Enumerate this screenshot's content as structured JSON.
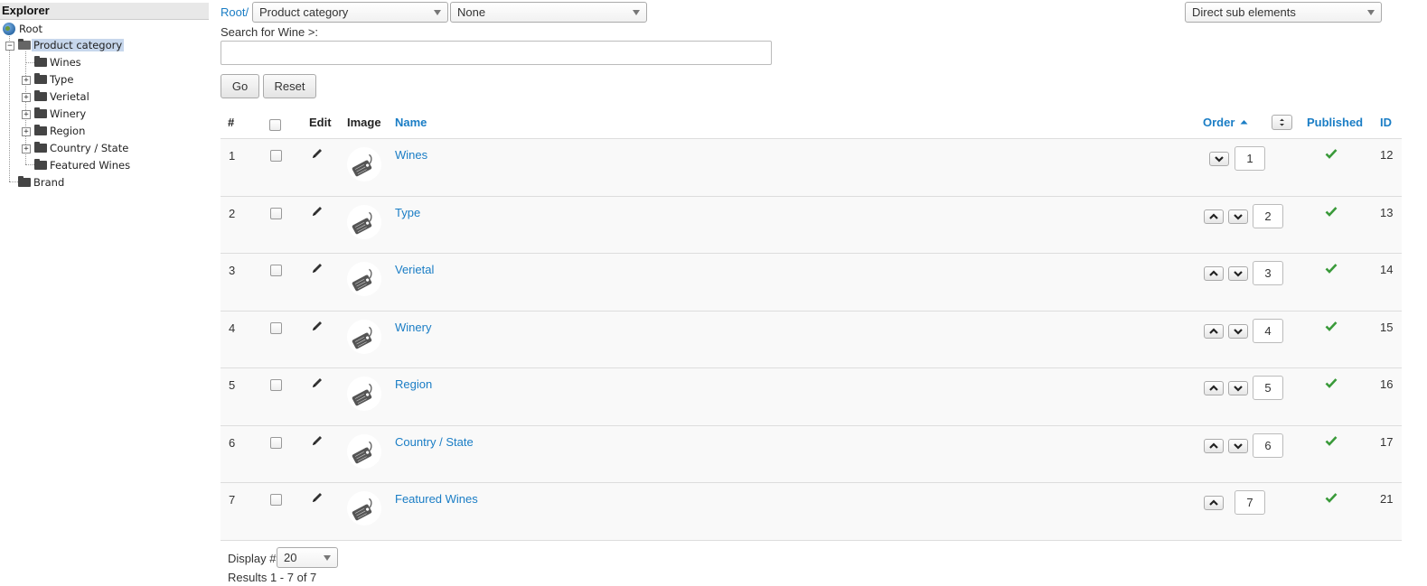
{
  "explorer": {
    "title": "Explorer",
    "root": "Root",
    "product_category": "Product category",
    "children": [
      "Wines",
      "Type",
      "Verietal",
      "Winery",
      "Region",
      "Country / State",
      "Featured Wines"
    ],
    "brand": "Brand"
  },
  "toolbar": {
    "root_link": "Root/",
    "category_select": "Product category",
    "sub_select": "None",
    "scope_select": "Direct sub elements",
    "search_label": "Search for Wine >:",
    "search_value": "",
    "go_label": "Go",
    "reset_label": "Reset"
  },
  "table": {
    "headers": {
      "num": "#",
      "edit": "Edit",
      "image": "Image",
      "name": "Name",
      "order": "Order",
      "published": "Published",
      "id": "ID"
    },
    "rows": [
      {
        "num": "1",
        "name": "Wines",
        "order": "1",
        "id": "12"
      },
      {
        "num": "2",
        "name": "Type",
        "order": "2",
        "id": "13"
      },
      {
        "num": "3",
        "name": "Verietal",
        "order": "3",
        "id": "14"
      },
      {
        "num": "4",
        "name": "Winery",
        "order": "4",
        "id": "15"
      },
      {
        "num": "5",
        "name": "Region",
        "order": "5",
        "id": "16"
      },
      {
        "num": "6",
        "name": "Country / State",
        "order": "6",
        "id": "17"
      },
      {
        "num": "7",
        "name": "Featured Wines",
        "order": "7",
        "id": "21"
      }
    ]
  },
  "footer": {
    "display_label": "Display #",
    "display_value": "20",
    "results": "Results 1 - 7 of 7"
  },
  "colors": {
    "link": "#1a7dc5",
    "published_check": "#3a9a3a",
    "row_bg": "#f9f9f9",
    "tree_selected": "#c7d7ec"
  }
}
